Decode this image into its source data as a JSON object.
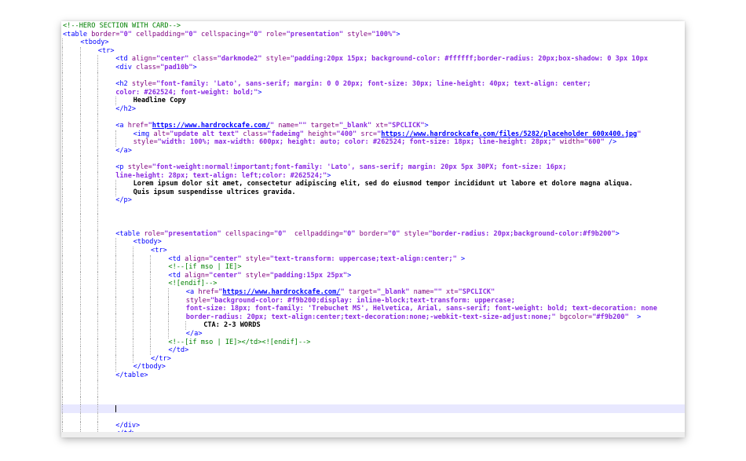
{
  "editor": {
    "colors": {
      "tag": "#0000ff",
      "attribute": "#7f007f",
      "value": "#8a2be2",
      "comment": "#008000",
      "text": "#000000",
      "current_line": "#e8e8ff"
    },
    "current_line_index": 46,
    "lines": [
      {
        "indent": 0,
        "tokens": [
          [
            "comment",
            "<!--HERO SECTION WITH CARD-->"
          ]
        ]
      },
      {
        "indent": 0,
        "tokens": [
          [
            "tag",
            "<table "
          ],
          [
            "attr",
            "border="
          ],
          [
            "val",
            "\"0\""
          ],
          [
            "attr",
            " cellpadding="
          ],
          [
            "val",
            "\"0\""
          ],
          [
            "attr",
            " cellspacing="
          ],
          [
            "val",
            "\"0\""
          ],
          [
            "attr",
            " role="
          ],
          [
            "val",
            "\"presentation\""
          ],
          [
            "attr",
            " style="
          ],
          [
            "val",
            "\"100%\""
          ],
          [
            "tag",
            ">"
          ]
        ]
      },
      {
        "indent": 1,
        "tokens": [
          [
            "tag",
            "<tbody>"
          ]
        ]
      },
      {
        "indent": 2,
        "tokens": [
          [
            "tag",
            "<tr>"
          ]
        ]
      },
      {
        "indent": 3,
        "tokens": [
          [
            "tag",
            "<td "
          ],
          [
            "attr",
            "align="
          ],
          [
            "val",
            "\"center\""
          ],
          [
            "attr",
            " class="
          ],
          [
            "val",
            "\"darkmode2\""
          ],
          [
            "attr",
            " style="
          ],
          [
            "val",
            "\"padding:20px 15px; background-color: #ffffff;border-radius: 20px;box-shadow: 0 3px 10px"
          ]
        ]
      },
      {
        "indent": 3,
        "tokens": [
          [
            "tag",
            "<div "
          ],
          [
            "attr",
            "class="
          ],
          [
            "val",
            "\"pad10b\""
          ],
          [
            "tag",
            ">"
          ]
        ]
      },
      {
        "indent": 3,
        "tokens": []
      },
      {
        "indent": 3,
        "tokens": [
          [
            "tag",
            "<h2 "
          ],
          [
            "attr",
            "style="
          ],
          [
            "val",
            "\"font-family: 'Lato', sans-serif; margin: 0 0 20px; font-size: 30px; line-height: 40px; text-align: center;"
          ]
        ]
      },
      {
        "indent": 3,
        "tokens": [
          [
            "val",
            "color: #262524; font-weight: bold;\""
          ],
          [
            "tag",
            ">"
          ]
        ]
      },
      {
        "indent": 4,
        "tokens": [
          [
            "text",
            "Headline Copy"
          ]
        ]
      },
      {
        "indent": 3,
        "tokens": [
          [
            "tag",
            "</h2>"
          ]
        ]
      },
      {
        "indent": 3,
        "tokens": []
      },
      {
        "indent": 3,
        "tokens": [
          [
            "tag",
            "<a "
          ],
          [
            "attr",
            "href="
          ],
          [
            "val",
            "\""
          ],
          [
            "url",
            "https://www.hardrockcafe.com/"
          ],
          [
            "val",
            "\""
          ],
          [
            "attr",
            " name="
          ],
          [
            "val",
            "\"\""
          ],
          [
            "attr",
            " target="
          ],
          [
            "val",
            "\"_blank\""
          ],
          [
            "attr",
            " xt="
          ],
          [
            "val",
            "\"SPCLICK\""
          ],
          [
            "tag",
            ">"
          ]
        ]
      },
      {
        "indent": 4,
        "tokens": [
          [
            "tag",
            "<img "
          ],
          [
            "attr",
            "alt="
          ],
          [
            "val",
            "\"update alt text\""
          ],
          [
            "attr",
            " class="
          ],
          [
            "val",
            "\"fadeimg\""
          ],
          [
            "attr",
            " height="
          ],
          [
            "val",
            "\"400\""
          ],
          [
            "attr",
            " src="
          ],
          [
            "val",
            "\""
          ],
          [
            "url",
            "https://www.hardrockcafe.com/files/5282/placeholder_600x400.jpg"
          ],
          [
            "val",
            "\""
          ]
        ]
      },
      {
        "indent": 4,
        "tokens": [
          [
            "attr",
            "style="
          ],
          [
            "val",
            "\"width: 100%; max-width: 600px; height: auto; color: #262524; font-size: 18px; line-height: 28px;\""
          ],
          [
            "attr",
            " width="
          ],
          [
            "val",
            "\"600\""
          ],
          [
            "tag",
            " />"
          ]
        ]
      },
      {
        "indent": 3,
        "tokens": [
          [
            "tag",
            "</a>"
          ]
        ]
      },
      {
        "indent": 3,
        "tokens": []
      },
      {
        "indent": 3,
        "tokens": [
          [
            "tag",
            "<p "
          ],
          [
            "attr",
            "style="
          ],
          [
            "val",
            "\"font-weight:normal!important;font-family: 'Lato', sans-serif; margin: 20px 5px 30PX; font-size: 16px;"
          ]
        ]
      },
      {
        "indent": 3,
        "tokens": [
          [
            "val",
            "line-height: 28px; text-align: left;color: #262524;\""
          ],
          [
            "tag",
            ">"
          ]
        ]
      },
      {
        "indent": 4,
        "tokens": [
          [
            "text",
            "Lorem ipsum dolor sit amet, consectetur adipiscing elit, sed do eiusmod tempor incididunt ut labore et dolore magna aliqua."
          ]
        ]
      },
      {
        "indent": 4,
        "tokens": [
          [
            "text",
            "Quis ipsum suspendisse ultrices gravida."
          ]
        ]
      },
      {
        "indent": 3,
        "tokens": [
          [
            "tag",
            "</p>"
          ]
        ]
      },
      {
        "indent": 3,
        "tokens": []
      },
      {
        "indent": 3,
        "tokens": []
      },
      {
        "indent": 3,
        "tokens": []
      },
      {
        "indent": 3,
        "tokens": [
          [
            "tag",
            "<table "
          ],
          [
            "attr",
            "role="
          ],
          [
            "val",
            "\"presentation\""
          ],
          [
            "attr",
            " cellspacing="
          ],
          [
            "val",
            "\"0\""
          ],
          [
            "attr",
            "  cellpadding="
          ],
          [
            "val",
            "\"0\""
          ],
          [
            "attr",
            " border="
          ],
          [
            "val",
            "\"0\""
          ],
          [
            "attr",
            " style="
          ],
          [
            "val",
            "\"border-radius: 20px;background-color:#f9b200\""
          ],
          [
            "tag",
            ">"
          ]
        ]
      },
      {
        "indent": 4,
        "tokens": [
          [
            "tag",
            "<tbody>"
          ]
        ]
      },
      {
        "indent": 5,
        "tokens": [
          [
            "tag",
            "<tr>"
          ]
        ]
      },
      {
        "indent": 6,
        "tokens": [
          [
            "tag",
            "<td "
          ],
          [
            "attr",
            "align="
          ],
          [
            "val",
            "\"center\""
          ],
          [
            "attr",
            " style="
          ],
          [
            "val",
            "\"text-transform: uppercase;text-align:center;\""
          ],
          [
            "tag",
            " >"
          ]
        ]
      },
      {
        "indent": 6,
        "tokens": [
          [
            "comment",
            "<!--[if mso | IE]>"
          ]
        ]
      },
      {
        "indent": 6,
        "tokens": [
          [
            "tag",
            "<td "
          ],
          [
            "attr",
            "align="
          ],
          [
            "val",
            "\"center\""
          ],
          [
            "attr",
            " style="
          ],
          [
            "val",
            "\"padding:15px 25px\""
          ],
          [
            "tag",
            ">"
          ]
        ]
      },
      {
        "indent": 6,
        "tokens": [
          [
            "comment",
            "<![endif]-->"
          ]
        ]
      },
      {
        "indent": 7,
        "tokens": [
          [
            "tag",
            "<a "
          ],
          [
            "attr",
            "href="
          ],
          [
            "val",
            "\""
          ],
          [
            "url",
            "https://www.hardrockcafe.com/"
          ],
          [
            "val",
            "\""
          ],
          [
            "attr",
            " target="
          ],
          [
            "val",
            "\"_blank\""
          ],
          [
            "attr",
            " name="
          ],
          [
            "val",
            "\"\""
          ],
          [
            "attr",
            " xt="
          ],
          [
            "val",
            "\"SPCLICK\""
          ]
        ]
      },
      {
        "indent": 7,
        "tokens": [
          [
            "attr",
            "style="
          ],
          [
            "val",
            "\"background-color: #f9b200;display: inline-block;text-transform: uppercase;"
          ]
        ]
      },
      {
        "indent": 7,
        "tokens": [
          [
            "val",
            "font-size: 18px; font-family: 'Trebuchet MS', Helvetica, Arial, sans-serif; font-weight: bold; text-decoration: none"
          ]
        ]
      },
      {
        "indent": 7,
        "tokens": [
          [
            "val",
            "border-radius: 20px; text-align:center;text-decoration:none;-webkit-text-size-adjust:none;\""
          ],
          [
            "attr",
            " bgcolor="
          ],
          [
            "val",
            "\"#f9b200\""
          ],
          [
            "tag",
            "  >"
          ]
        ]
      },
      {
        "indent": 8,
        "tokens": [
          [
            "text",
            "CTA: 2-3 WORDS"
          ]
        ]
      },
      {
        "indent": 7,
        "tokens": [
          [
            "tag",
            "</a>"
          ]
        ]
      },
      {
        "indent": 6,
        "tokens": [
          [
            "comment",
            "<!--[if mso | IE]></td><![endif]-->"
          ]
        ]
      },
      {
        "indent": 6,
        "tokens": [
          [
            "tag",
            "</td>"
          ]
        ]
      },
      {
        "indent": 5,
        "tokens": [
          [
            "tag",
            "</tr>"
          ]
        ]
      },
      {
        "indent": 4,
        "tokens": [
          [
            "tag",
            "</tbody>"
          ]
        ]
      },
      {
        "indent": 3,
        "tokens": [
          [
            "tag",
            "</table>"
          ]
        ]
      },
      {
        "indent": 3,
        "tokens": []
      },
      {
        "indent": 3,
        "tokens": []
      },
      {
        "indent": 3,
        "tokens": []
      },
      {
        "indent": 3,
        "tokens": []
      },
      {
        "indent": 3,
        "tokens": []
      },
      {
        "indent": 3,
        "tokens": [
          [
            "tag",
            "</div>"
          ]
        ]
      },
      {
        "indent": 3,
        "tokens": [
          [
            "tag",
            "</td>"
          ]
        ]
      }
    ]
  }
}
